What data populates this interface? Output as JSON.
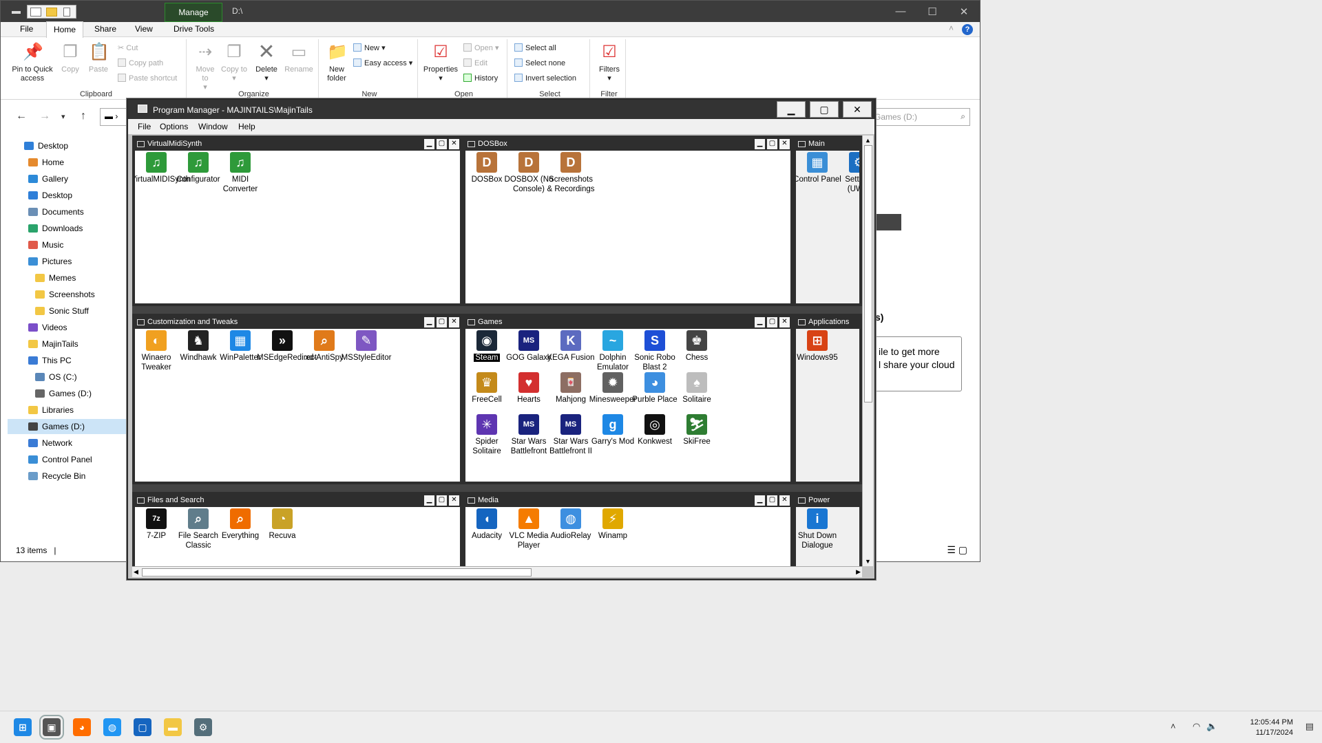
{
  "explorer": {
    "title_path": "D:\\",
    "manage_tab": "Manage",
    "tabs": [
      "File",
      "Home",
      "Share",
      "View",
      "Drive Tools"
    ],
    "ribbon": {
      "clipboard": {
        "name": "Clipboard",
        "pin": "Pin to Quick access",
        "copy": "Copy",
        "paste": "Paste",
        "cut": "Cut",
        "copy_path": "Copy path",
        "paste_shortcut": "Paste shortcut"
      },
      "organize": {
        "name": "Organize",
        "move_to": "Move to",
        "copy_to": "Copy to",
        "delete": "Delete",
        "rename": "Rename"
      },
      "new": {
        "name": "New",
        "new_folder": "New folder",
        "new_item": "New",
        "easy_access": "Easy access"
      },
      "open": {
        "name": "Open",
        "properties": "Properties",
        "open": "Open",
        "edit": "Edit",
        "history": "History"
      },
      "select": {
        "name": "Select",
        "select_all": "Select all",
        "select_none": "Select none",
        "invert": "Invert selection"
      },
      "filter": {
        "name": "Filter",
        "filters": "Filters"
      }
    },
    "search_placeholder": "Games (D:)",
    "nav_items": [
      {
        "label": "Desktop",
        "color": "#2f7fd8"
      },
      {
        "label": "Home",
        "color": "#e58a2e"
      },
      {
        "label": "Gallery",
        "color": "#2d8ad8"
      },
      {
        "label": "Desktop",
        "color": "#2f7fd8"
      },
      {
        "label": "Documents",
        "color": "#6b8fb5"
      },
      {
        "label": "Downloads",
        "color": "#2aa36b"
      },
      {
        "label": "Music",
        "color": "#e05a4a"
      },
      {
        "label": "Pictures",
        "color": "#3b8fd6"
      },
      {
        "label": "Memes",
        "color": "#f2c744"
      },
      {
        "label": "Screenshots",
        "color": "#f2c744"
      },
      {
        "label": "Sonic Stuff",
        "color": "#f2c744"
      },
      {
        "label": "Videos",
        "color": "#7b4fc9"
      },
      {
        "label": "MajinTails",
        "color": "#f2c744"
      },
      {
        "label": "This PC",
        "color": "#3a7bd5"
      },
      {
        "label": "OS (C:)",
        "color": "#5a87b8"
      },
      {
        "label": "Games (D:)",
        "color": "#666666"
      },
      {
        "label": "Libraries",
        "color": "#f2c744"
      },
      {
        "label": "Games (D:)",
        "color": "#444444"
      },
      {
        "label": "Network",
        "color": "#3a7bd5"
      },
      {
        "label": "Control Panel",
        "color": "#3a8ed6"
      },
      {
        "label": "Recycle Bin",
        "color": "#6a9cc9"
      }
    ],
    "status": "13 items",
    "right_partial_title": "s)",
    "right_partial_box": "ile to get more\nl share your cloud"
  },
  "progman": {
    "title": "Program Manager - MAJINTAILS\\MajinTails",
    "menu": [
      "File",
      "Options",
      "Window",
      "Help"
    ],
    "groups": [
      {
        "name": "VirtualMidiSynth",
        "items": [
          {
            "label": "VirtualMIDISynth",
            "icon": "music-note-icon",
            "color": "#2e9a3a"
          },
          {
            "label": "Configurator",
            "icon": "music-note-icon",
            "color": "#2e9a3a"
          },
          {
            "label": "MIDI Converter",
            "icon": "music-note-icon",
            "color": "#2e9a3a"
          }
        ]
      },
      {
        "name": "DOSBox",
        "items": [
          {
            "label": "DOSBox",
            "icon": "dosbox-icon",
            "color": "#b8733a"
          },
          {
            "label": "DOSBOX (No Console)",
            "icon": "dosbox-icon",
            "color": "#b8733a"
          },
          {
            "label": "Screenshots & Recordings",
            "icon": "dosbox-icon",
            "color": "#b8733a"
          }
        ]
      },
      {
        "name": "Main",
        "items": [
          {
            "label": "Control Panel",
            "icon": "control-panel-icon",
            "color": "#3a8ed6"
          },
          {
            "label": "Settings (UWP)",
            "icon": "gear-icon",
            "color": "#1c6fc2"
          }
        ]
      },
      {
        "name": "Customization and Tweaks",
        "items": [
          {
            "label": "Winaero Tweaker",
            "icon": "winaero-icon",
            "color": "#f0a020"
          },
          {
            "label": "Windhawk",
            "icon": "windhawk-icon",
            "color": "#222222"
          },
          {
            "label": "WinPaletter",
            "icon": "winpaletter-icon",
            "color": "#1e88e5"
          },
          {
            "label": "MSEdgeRedirect",
            "icon": "msedgeredirect-icon",
            "color": "#111111"
          },
          {
            "label": "xd-AntiSpy",
            "icon": "magnifier-icon",
            "color": "#e07a1a"
          },
          {
            "label": "MSStyleEditor",
            "icon": "style-editor-icon",
            "color": "#7e57c2"
          }
        ]
      },
      {
        "name": "Games",
        "items": [
          {
            "label": "Steam",
            "icon": "steam-icon",
            "color": "#1b2838",
            "selected": true
          },
          {
            "label": "GOG Galaxy",
            "icon": "msdos-icon",
            "color": "#1a237e"
          },
          {
            "label": "KEGA Fusion",
            "icon": "kega-icon",
            "color": "#5c6bc0"
          },
          {
            "label": "Dolphin Emulator",
            "icon": "dolphin-icon",
            "color": "#29a6e0"
          },
          {
            "label": "Sonic Robo Blast 2",
            "icon": "sonic-icon",
            "color": "#1e4fd6"
          },
          {
            "label": "Chess",
            "icon": "chess-icon",
            "color": "#444444"
          },
          {
            "label": "FreeCell",
            "icon": "freecell-icon",
            "color": "#c48a1a"
          },
          {
            "label": "Hearts",
            "icon": "hearts-icon",
            "color": "#d32f2f"
          },
          {
            "label": "Mahjong",
            "icon": "mahjong-icon",
            "color": "#8d6e63"
          },
          {
            "label": "Minesweeper",
            "icon": "minesweeper-icon",
            "color": "#616161"
          },
          {
            "label": "Purble Place",
            "icon": "purble-icon",
            "color": "#3d8fe0"
          },
          {
            "label": "Solitaire",
            "icon": "solitaire-icon",
            "color": "#bdbdbd"
          },
          {
            "label": "Spider Solitaire",
            "icon": "spider-icon",
            "color": "#5e35b1"
          },
          {
            "label": "Star Wars Battlefront",
            "icon": "msdos-icon",
            "color": "#1a237e"
          },
          {
            "label": "Star Wars Battlefront II",
            "icon": "msdos-icon",
            "color": "#1a237e"
          },
          {
            "label": "Garry's Mod",
            "icon": "gmod-icon",
            "color": "#1e88e5"
          },
          {
            "label": "Konkwest",
            "icon": "konkwest-icon",
            "color": "#111111"
          },
          {
            "label": "SkiFree",
            "icon": "skifree-icon",
            "color": "#2e7d32"
          }
        ]
      },
      {
        "name": "Applications",
        "items": [
          {
            "label": "Windows95",
            "icon": "windows95-icon",
            "color": "#d84315"
          }
        ]
      },
      {
        "name": "Files and Search",
        "items": [
          {
            "label": "7-ZIP",
            "icon": "7zip-icon",
            "color": "#111111"
          },
          {
            "label": "File Search Classic",
            "icon": "magnifier-icon",
            "color": "#607d8b"
          },
          {
            "label": "Everything",
            "icon": "everything-icon",
            "color": "#ef6c00"
          },
          {
            "label": "Recuva",
            "icon": "recuva-icon",
            "color": "#c9a227"
          }
        ]
      },
      {
        "name": "Media",
        "items": [
          {
            "label": "Audacity",
            "icon": "audacity-icon",
            "color": "#1565c0"
          },
          {
            "label": "VLC Media Player",
            "icon": "vlc-icon",
            "color": "#f57c00"
          },
          {
            "label": "AudioRelay",
            "icon": "audiorelay-icon",
            "color": "#3d8fe0"
          },
          {
            "label": "Winamp",
            "icon": "winamp-icon",
            "color": "#e0a800"
          }
        ]
      },
      {
        "name": "Power",
        "items": [
          {
            "label": "Shut Down Dialogue",
            "icon": "info-icon",
            "color": "#1976d2"
          }
        ]
      }
    ]
  },
  "taskbar": {
    "apps": [
      {
        "name": "start-icon",
        "color": "#1e88e5"
      },
      {
        "name": "program-manager-icon",
        "color": "#555555"
      },
      {
        "name": "firefox-icon",
        "color": "#ff6d00"
      },
      {
        "name": "audiorelay-icon",
        "color": "#2196f3"
      },
      {
        "name": "window-app-icon",
        "color": "#1565c0"
      },
      {
        "name": "file-explorer-icon",
        "color": "#f2c744"
      },
      {
        "name": "settings-icon",
        "color": "#546e7a"
      }
    ],
    "time": "12:05:44 PM",
    "date": "11/17/2024"
  }
}
